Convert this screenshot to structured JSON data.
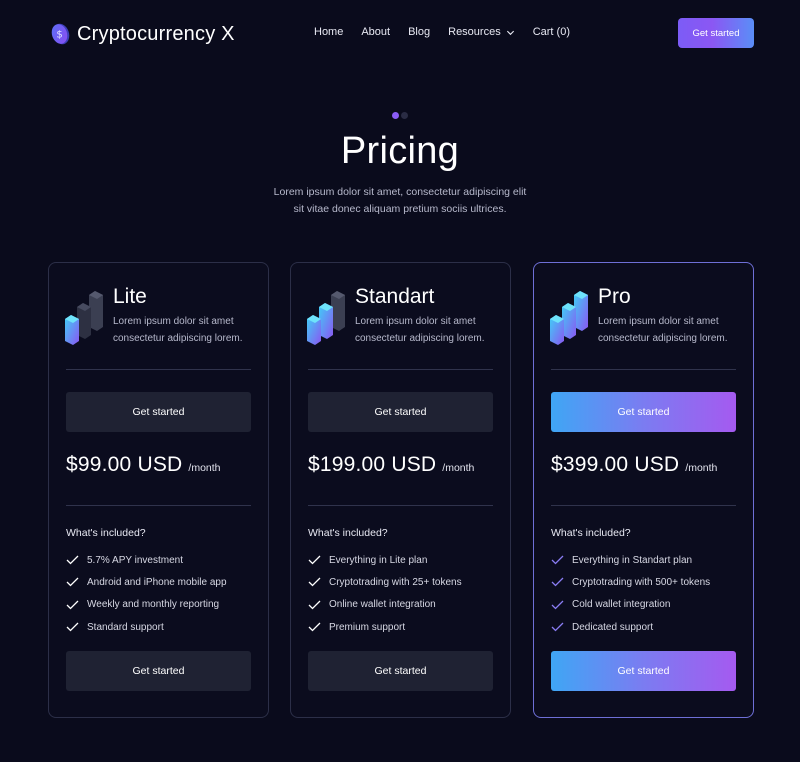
{
  "brand": {
    "name": "Cryptocurrency X",
    "logo_glyph": "$"
  },
  "nav": {
    "items": [
      "Home",
      "About",
      "Blog",
      "Resources",
      "Cart (0)"
    ],
    "cta": "Get started"
  },
  "hero": {
    "title": "Pricing",
    "subtitle": "Lorem ipsum dolor sit amet, consectetur adipiscing elit sit vitae donec aliquam pretium sociis ultrices."
  },
  "plans": [
    {
      "name": "Lite",
      "description": "Lorem ipsum dolor sit amet consectetur adipiscing lorem.",
      "cta": "Get started",
      "price": "$99.00 USD",
      "period": "/month",
      "included_title": "What's included?",
      "features": [
        "5.7% APY investment",
        "Android and iPhone mobile app",
        "Weekly and monthly reporting",
        "Standard support"
      ]
    },
    {
      "name": "Standart",
      "description": "Lorem ipsum dolor sit amet consectetur adipiscing lorem.",
      "cta": "Get started",
      "price": "$199.00 USD",
      "period": "/month",
      "included_title": "What's included?",
      "features": [
        "Everything in Lite plan",
        "Cryptotrading with 25+ tokens",
        "Online wallet integration",
        "Premium support"
      ]
    },
    {
      "name": "Pro",
      "description": "Lorem ipsum dolor sit amet consectetur adipiscing lorem.",
      "cta": "Get started",
      "price": "$399.00 USD",
      "period": "/month",
      "included_title": "What's included?",
      "features": [
        "Everything in Standart plan",
        "Cryptotrading with 500+ tokens",
        "Cold wallet integration",
        "Dedicated support"
      ]
    }
  ],
  "colors": {
    "background": "#0a0b1c",
    "accent_purple": "#8b5cf6",
    "accent_blue": "#3fa6f5",
    "card_border": "#2c2f48",
    "pro_border": "#6e6fd6",
    "button_dark": "#1f2233"
  },
  "icons": {
    "logo": "coin-icon",
    "resources_caret": "chevron-down-icon",
    "plan_icon": "bar-blocks-icon",
    "feature_check": "check-icon"
  }
}
